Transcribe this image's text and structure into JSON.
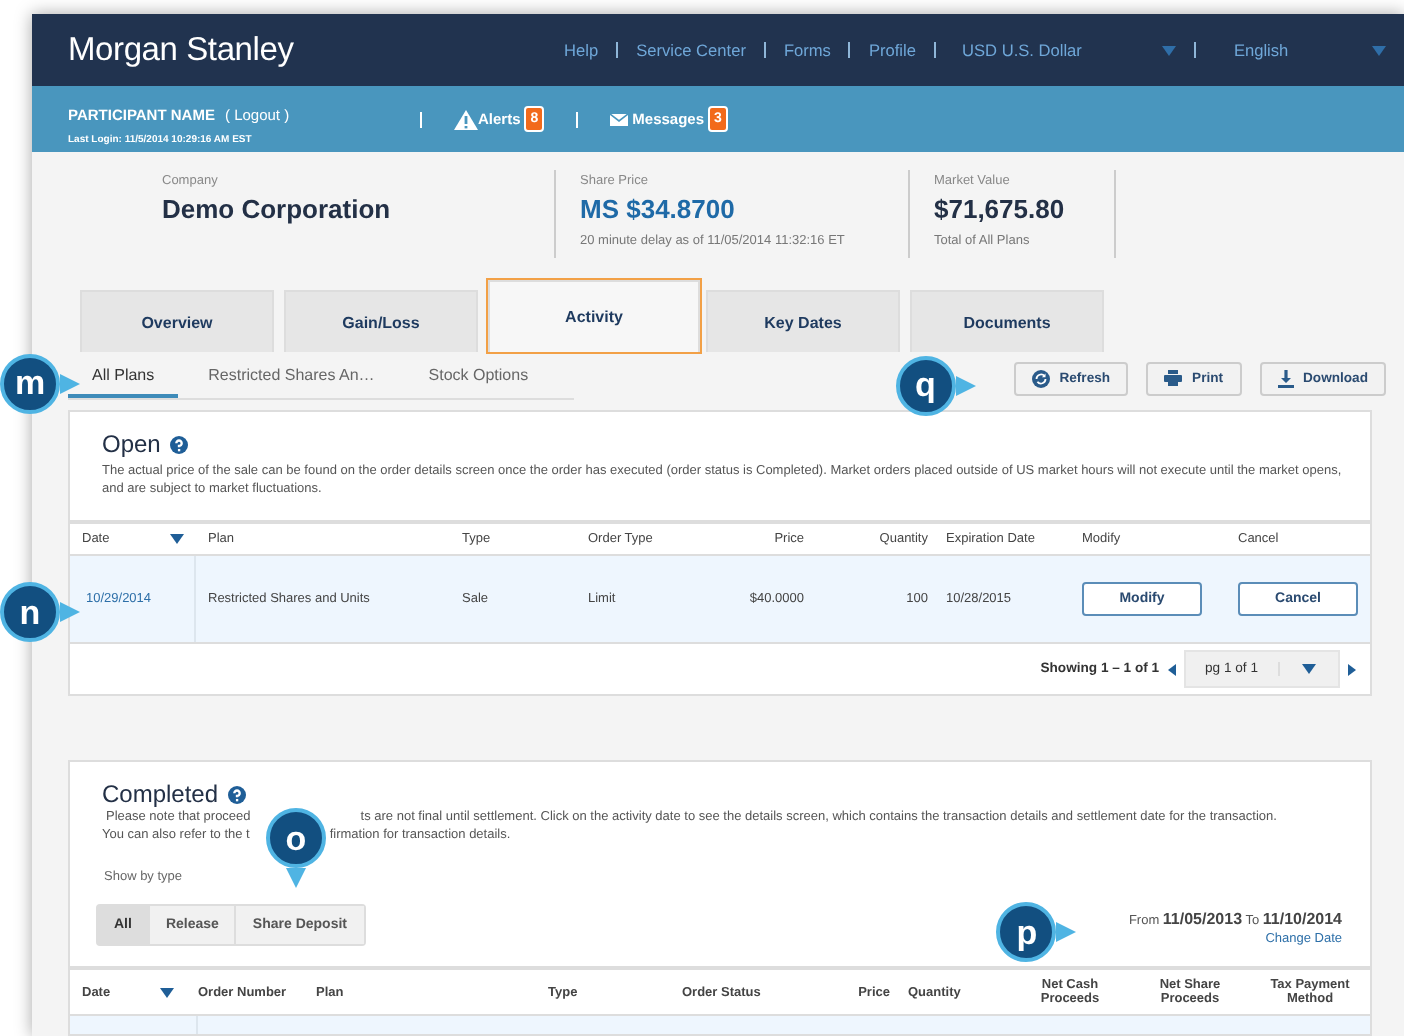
{
  "header": {
    "logo": "Morgan Stanley",
    "links": [
      "Help",
      "Service Center",
      "Forms",
      "Profile"
    ],
    "selects": [
      {
        "value": "USD U.S. Dollar"
      },
      {
        "value": "English"
      }
    ]
  },
  "user_bar": {
    "name": "PARTICIPANT NAME",
    "logout": "( Logout )",
    "last_login": "Last Login: 11/5/2014 10:29:16 AM  EST",
    "alerts": {
      "label": "Alerts",
      "count": "8"
    },
    "messages": {
      "label": "Messages",
      "count": "3"
    }
  },
  "summary": [
    {
      "label": "Company",
      "value": "Demo Corporation",
      "kind": "dark"
    },
    {
      "label": "Share Price",
      "value": "MS $34.8700",
      "note": "20 minute delay as of 11/05/2014 11:32:16 ET",
      "kind": "blue"
    },
    {
      "label": "Market Value",
      "value": "$71,675.80",
      "note": "Total of All Plans",
      "kind": "dark"
    }
  ],
  "tabs": [
    {
      "label": "Overview",
      "selected": false
    },
    {
      "label": "Gain/Loss",
      "selected": false
    },
    {
      "label": "Activity",
      "selected": true
    },
    {
      "label": "Key Dates",
      "selected": false
    },
    {
      "label": "Documents",
      "selected": false
    }
  ],
  "subtabs": {
    "callout": "m",
    "items": [
      {
        "label": "All Plans",
        "selected": true
      },
      {
        "label": "Restricted Shares An…",
        "selected": false
      },
      {
        "label": "Stock Options",
        "selected": false
      }
    ]
  },
  "toolbar": {
    "callout": "q",
    "buttons": [
      {
        "label": "Refresh",
        "kind": "refresh"
      },
      {
        "label": "Print",
        "kind": "print"
      },
      {
        "label": "Download",
        "kind": "download"
      }
    ]
  },
  "open": {
    "title": "Open",
    "text": "The actual price of the sale can be found on the order details screen once the order has executed (order status is Completed).  Market orders placed outside of US market hours will not execute until the market opens, and are subject to market fluctuations.",
    "columns": [
      "Date",
      "Plan",
      "Type",
      "Order Type",
      "Price",
      "Quantity",
      "Expiration Date",
      "Modify",
      "Cancel"
    ],
    "row_callout": "n",
    "rows": [
      {
        "date": "10/29/2014",
        "plan": "Restricted Shares and Units",
        "type": "Sale",
        "order_type": "Limit",
        "price": "$40.0000",
        "quantity": "100",
        "expiration": "10/28/2015",
        "modify": "Modify",
        "cancel": "Cancel"
      }
    ],
    "pagination": {
      "showing": "Showing 1 – 1 of 1",
      "page": "pg 1 of 1"
    }
  },
  "completed": {
    "title": "Completed",
    "text_lines": [
      [
        "Please note that proceed",
        "ts are not final until settlement. Click on the activity date to see the details screen, which contains the transaction details and settlement date for the transaction."
      ],
      [
        "You can also refer to the t",
        "firmation for transaction details."
      ]
    ],
    "text_callout": "o",
    "show_by": "Show by type",
    "filters": [
      {
        "label": "All",
        "selected": true
      },
      {
        "label": "Release",
        "selected": false
      },
      {
        "label": "Share Deposit",
        "selected": false
      }
    ],
    "range": {
      "callout": "p",
      "from_label": "From",
      "from": "11/05/2013",
      "to_label": "To",
      "to": "11/10/2014",
      "change": "Change Date"
    },
    "columns": [
      "Date",
      "Order Number",
      "Plan",
      "Type",
      "Order Status",
      "Price",
      "Quantity",
      "Net Cash Proceeds",
      "Net Share Proceeds",
      "Tax Payment Method"
    ]
  }
}
